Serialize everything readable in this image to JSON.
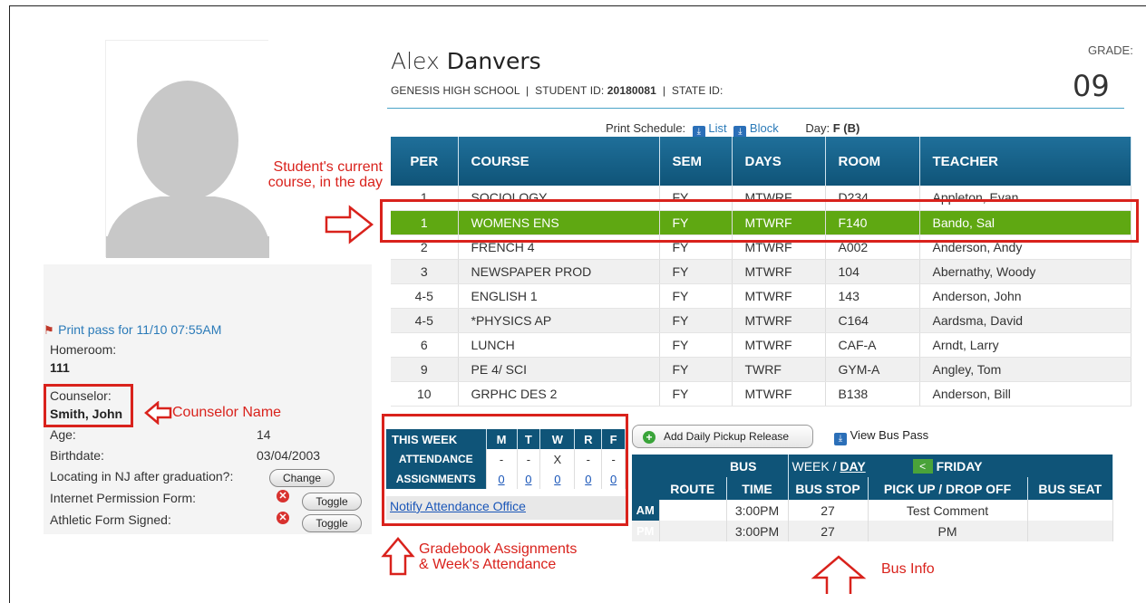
{
  "student": {
    "first_name": "Alex",
    "last_name": "Danvers",
    "school": "GENESIS HIGH SCHOOL",
    "student_id_label": "STUDENT ID:",
    "student_id": "20180081",
    "state_id_label": "STATE ID:",
    "grade_label": "GRADE:",
    "grade": "09"
  },
  "left": {
    "print_pass": "Print pass for 11/10 07:55AM",
    "homeroom_label": "Homeroom:",
    "homeroom": "111",
    "counselor_label": "Counselor:",
    "counselor": "Smith, John",
    "age_label": "Age:",
    "age": "14",
    "birthdate_label": "Birthdate:",
    "birthdate": "03/04/2003",
    "locating_label": "Locating in NJ after graduation?:",
    "change_btn": "Change",
    "internet_label": "Internet Permission Form:",
    "athletic_label": "Athletic Form Signed:",
    "toggle_btn": "Toggle",
    "x_glyph": "✕"
  },
  "schedule_bar": {
    "print_label": "Print Schedule:",
    "list": "List",
    "block": "Block",
    "day_label": "Day:",
    "day_value": "F (B)"
  },
  "schedule": {
    "headers": [
      "PER",
      "COURSE",
      "SEM",
      "DAYS",
      "ROOM",
      "TEACHER"
    ],
    "rows": [
      [
        "1",
        "SOCIOLOGY",
        "FY",
        "MTWRF",
        "D234",
        "Appleton, Evan"
      ],
      [
        "1",
        "WOMENS ENS",
        "FY",
        "MTWRF",
        "F140",
        "Bando, Sal"
      ],
      [
        "2",
        "FRENCH 4",
        "FY",
        "MTWRF",
        "A002",
        "Anderson, Andy"
      ],
      [
        "3",
        "NEWSPAPER PROD",
        "FY",
        "MTWRF",
        "104",
        "Abernathy, Woody"
      ],
      [
        "4-5",
        "ENGLISH 1",
        "FY",
        "MTWRF",
        "143",
        "Anderson, John"
      ],
      [
        "4-5",
        "*PHYSICS AP",
        "FY",
        "MTWRF",
        "C164",
        "Aardsma, David"
      ],
      [
        "6",
        "LUNCH",
        "FY",
        "MTWRF",
        "CAF-A",
        "Arndt, Larry"
      ],
      [
        "9",
        "PE 4/ SCI",
        "FY",
        "TWRF",
        "GYM-A",
        "Angley, Tom"
      ],
      [
        "10",
        "GRPHC DES 2",
        "FY",
        "MTWRF",
        "B138",
        "Anderson, Bill"
      ]
    ]
  },
  "week": {
    "title": "THIS WEEK",
    "days": [
      "M",
      "T",
      "W",
      "R",
      "F"
    ],
    "attendance_label": "ATTENDANCE",
    "attendance": [
      "-",
      "-",
      "X",
      "-",
      "-"
    ],
    "assignments_label": "ASSIGNMENTS",
    "assignments": [
      "0",
      "0",
      "0",
      "0",
      "0"
    ],
    "notify_link": "Notify Attendance Office"
  },
  "bus": {
    "pickup_btn": "Add Daily Pickup Release",
    "pickup_plus": "+",
    "view_pass": "View Bus Pass",
    "title": "BUS",
    "week_label": "WEEK / ",
    "day_link": "DAY",
    "prev": "<",
    "day_name": "FRIDAY",
    "headers": [
      "ROUTE",
      "TIME",
      "BUS STOP",
      "PICK UP / DROP OFF",
      "BUS SEAT"
    ],
    "rows": [
      {
        "period": "AM",
        "route": "",
        "time": "3:00PM",
        "stop": "27",
        "pickup": "Test Comment",
        "seat": ""
      },
      {
        "period": "PM",
        "route": "",
        "time": "3:00PM",
        "stop": "27",
        "pickup": "PM",
        "seat": ""
      }
    ]
  },
  "annotations": {
    "current_course": "Student's current\ncourse, in the day",
    "counselor_name": "Counselor Name",
    "gradebook": "Gradebook Assignments\n& Week's Attendance",
    "bus_info": "Bus Info"
  },
  "colors": {
    "header_blue": "#0f5478",
    "current_green": "#5fa812",
    "annotation_red": "#d9221c"
  }
}
